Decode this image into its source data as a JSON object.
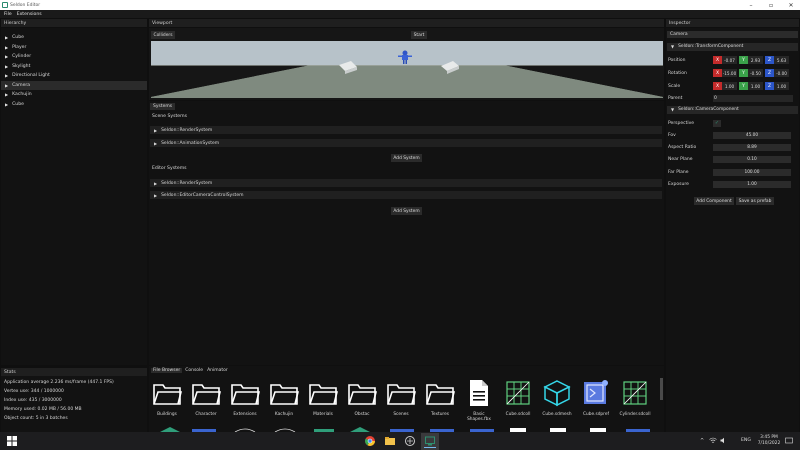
{
  "window": {
    "title": "Seldon Editor"
  },
  "menu": {
    "file": "File",
    "extensions": "Extensions"
  },
  "hierarchy": {
    "title": "Hierarchy",
    "items": [
      {
        "label": "Cube",
        "selected": false
      },
      {
        "label": "Player",
        "selected": false
      },
      {
        "label": "Cylinder",
        "selected": false
      },
      {
        "label": "Skylight",
        "selected": false
      },
      {
        "label": "Directional Light",
        "selected": false
      },
      {
        "label": "Camera",
        "selected": true
      },
      {
        "label": "Kachujin",
        "selected": false
      },
      {
        "label": "Cube",
        "selected": false
      }
    ]
  },
  "viewport": {
    "title": "Viewport",
    "colliders_label": "Colliders",
    "start_label": "Start"
  },
  "systems": {
    "tab_label": "Systems",
    "scene_label": "Scene Systems",
    "scene_items": [
      "Seldon::RenderSystem",
      "Seldon::AnimationSystem"
    ],
    "add_label": "Add System",
    "editor_label": "Editor Systems",
    "editor_items": [
      "Seldon::RenderSystem",
      "Seldon::EditorCameraControlSystem"
    ],
    "add_label2": "Add System"
  },
  "inspector": {
    "title": "Inspector",
    "name_value": "Camera",
    "transform_title": "Seldon::TransformComponent",
    "position": {
      "label": "Position",
      "x": "-0.07",
      "y": "2.93",
      "z": "5.63"
    },
    "rotation": {
      "label": "Rotation",
      "x": "-15.00",
      "y": "-0.50",
      "z": "-0.00"
    },
    "scale": {
      "label": "Scale",
      "x": "1.00",
      "y": "1.00",
      "z": "1.00"
    },
    "axis": {
      "x": "X",
      "y": "Y",
      "z": "Z"
    },
    "parent": {
      "label": "Parent",
      "value": "0"
    },
    "camera_title": "Seldon::CameraComponent",
    "perspective_label": "Perspective",
    "perspective_checked": true,
    "fov": {
      "label": "Fov",
      "value": "45.00"
    },
    "aspect": {
      "label": "Aspect Ratio",
      "value": "8.89"
    },
    "near": {
      "label": "Near Plane",
      "value": "0.10"
    },
    "far": {
      "label": "Far Plane",
      "value": "100.00"
    },
    "exposure": {
      "label": "Exposure",
      "value": "1.00"
    },
    "add_component": "Add Component",
    "save_prefab": "Save as prefab"
  },
  "stats": {
    "title": "Stats",
    "lines": [
      "Application average 2.236 ms/frame (447.1 FPS)",
      "Vertex use: 344 / 1000000",
      "Index use: 435 / 3000000",
      "Memory used: 0.02 MB / 56.00 MB",
      "Object count: 5 in 3 batches"
    ]
  },
  "bottom_tabs": {
    "file_browser": "File Browser",
    "console": "Console",
    "animator": "Animator"
  },
  "files": [
    {
      "name": "Buildings",
      "icon": "folder-icon"
    },
    {
      "name": "Character",
      "icon": "folder-icon"
    },
    {
      "name": "Extensions",
      "icon": "folder-icon"
    },
    {
      "name": "Kachujin",
      "icon": "folder-icon"
    },
    {
      "name": "Materials",
      "icon": "folder-icon"
    },
    {
      "name": "Obstac",
      "icon": "folder-icon"
    },
    {
      "name": "Scenes",
      "icon": "folder-icon"
    },
    {
      "name": "Textures",
      "icon": "folder-icon"
    },
    {
      "name": "Basic Shapes.fbx",
      "icon": "document-icon"
    },
    {
      "name": "Cube.sdcoll",
      "icon": "collider-grid-icon"
    },
    {
      "name": "Cube.sdmesh",
      "icon": "mesh-cube-icon"
    },
    {
      "name": "Cube.sdpref",
      "icon": "prefab-icon"
    },
    {
      "name": "Cylinder.sdcoll",
      "icon": "collider-grid-icon"
    }
  ],
  "taskbar": {
    "lang": "ENG",
    "time": "3:45 PM",
    "date": "7/10/2022"
  },
  "colors": {
    "x_axis": "#c42b2b",
    "y_axis": "#3aa24a",
    "z_axis": "#2c56c9",
    "accent": "#2e8e6f"
  }
}
